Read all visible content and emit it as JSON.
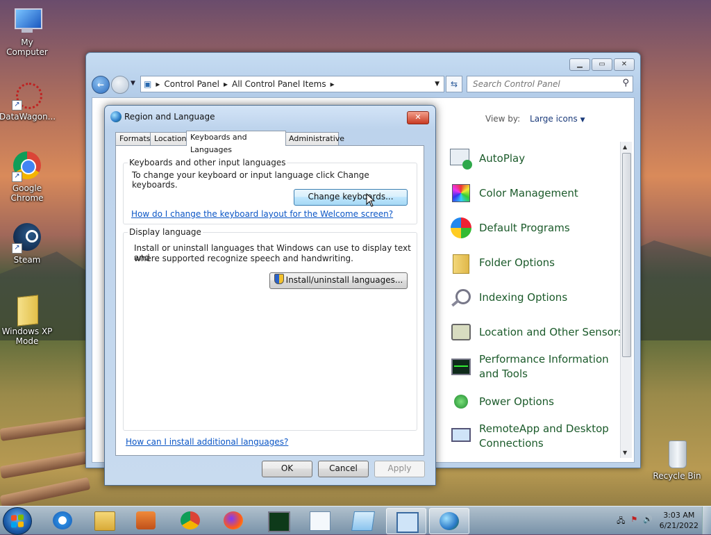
{
  "desktop": {
    "icons": [
      {
        "name": "my-computer",
        "label": "My Computer"
      },
      {
        "name": "datawagon",
        "label": "DataWagon..."
      },
      {
        "name": "google-chrome",
        "label": "Google Chrome"
      },
      {
        "name": "steam",
        "label": "Steam"
      },
      {
        "name": "windows-xp-mode",
        "label": "Windows XP Mode"
      },
      {
        "name": "recycle-bin",
        "label": "Recycle Bin"
      }
    ]
  },
  "control_panel": {
    "breadcrumb": [
      "Control Panel",
      "All Control Panel Items"
    ],
    "search_placeholder": "Search Control Panel",
    "view_by_label": "View by:",
    "view_by_value": "Large icons",
    "items": [
      {
        "label": "AutoPlay",
        "icon": "autoplay-icon"
      },
      {
        "label": "Color Management",
        "icon": "color-management-icon"
      },
      {
        "label": "Default Programs",
        "icon": "default-programs-icon"
      },
      {
        "label": "Folder Options",
        "icon": "folder-options-icon"
      },
      {
        "label": "Indexing Options",
        "icon": "indexing-options-icon"
      },
      {
        "label": "Location and Other Sensors",
        "icon": "location-sensors-icon"
      },
      {
        "label": "Performance Information and Tools",
        "icon": "performance-icon"
      },
      {
        "label": "Power Options",
        "icon": "power-options-icon"
      },
      {
        "label": "RemoteApp and Desktop Connections",
        "icon": "remoteapp-icon"
      }
    ]
  },
  "dialog": {
    "title": "Region and Language",
    "tabs": [
      "Formats",
      "Location",
      "Keyboards and Languages",
      "Administrative"
    ],
    "active_tab": "Keyboards and Languages",
    "keyboards_group": {
      "title": "Keyboards and other input languages",
      "description": "To change your keyboard or input language click Change keyboards.",
      "button": "Change keyboards...",
      "link": "How do I change the keyboard layout for the Welcome screen?"
    },
    "display_group": {
      "title": "Display language",
      "description_line1": "Install or uninstall languages that Windows can use to display text and",
      "description_line2": "where supported recognize speech and handwriting.",
      "button": "Install/uninstall languages..."
    },
    "bottom_link": "How can I install additional languages?",
    "buttons": {
      "ok": "OK",
      "cancel": "Cancel",
      "apply": "Apply"
    }
  },
  "taskbar": {
    "clock_time": "3:03 AM",
    "clock_date": "6/21/2022"
  }
}
